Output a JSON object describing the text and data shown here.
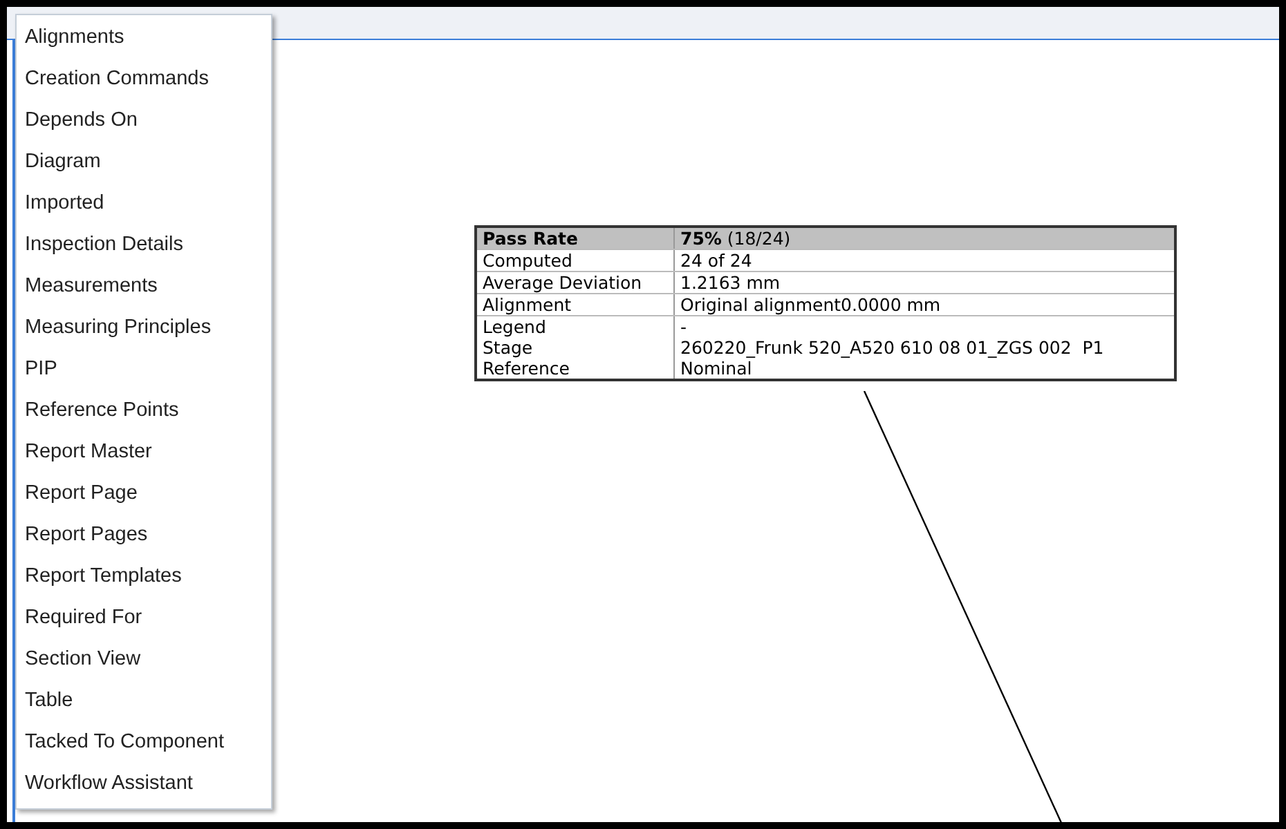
{
  "menu": {
    "items": [
      {
        "label": "Alignments"
      },
      {
        "label": "Creation Commands"
      },
      {
        "label": "Depends On"
      },
      {
        "label": "Diagram"
      },
      {
        "label": "Imported"
      },
      {
        "label": "Inspection Details"
      },
      {
        "label": "Measurements"
      },
      {
        "label": "Measuring Principles"
      },
      {
        "label": "PIP"
      },
      {
        "label": "Reference Points"
      },
      {
        "label": "Report Master"
      },
      {
        "label": "Report Page"
      },
      {
        "label": "Report Pages"
      },
      {
        "label": "Report Templates"
      },
      {
        "label": "Required For"
      },
      {
        "label": "Section View"
      },
      {
        "label": "Table"
      },
      {
        "label": "Tacked To Component"
      },
      {
        "label": "Workflow Assistant"
      }
    ]
  },
  "label_table": {
    "rows": [
      {
        "kind": "header",
        "labels": [
          "Pass Rate"
        ],
        "values": [
          "**75%** (18/24)"
        ]
      },
      {
        "kind": "row",
        "labels": [
          "Computed"
        ],
        "values": [
          "24 of 24"
        ]
      },
      {
        "kind": "row",
        "labels": [
          "Average Deviation"
        ],
        "values": [
          "1.2163 mm"
        ]
      },
      {
        "kind": "row",
        "labels": [
          "Alignment"
        ],
        "values": [
          "Original alignment0.0000 mm"
        ]
      },
      {
        "kind": "row",
        "labels": [
          "Legend",
          "Stage",
          "Reference"
        ],
        "values": [
          "-",
          "260220_Frunk 520_A520 610 08 01_ZGS 002  P1",
          "Nominal"
        ]
      }
    ]
  }
}
